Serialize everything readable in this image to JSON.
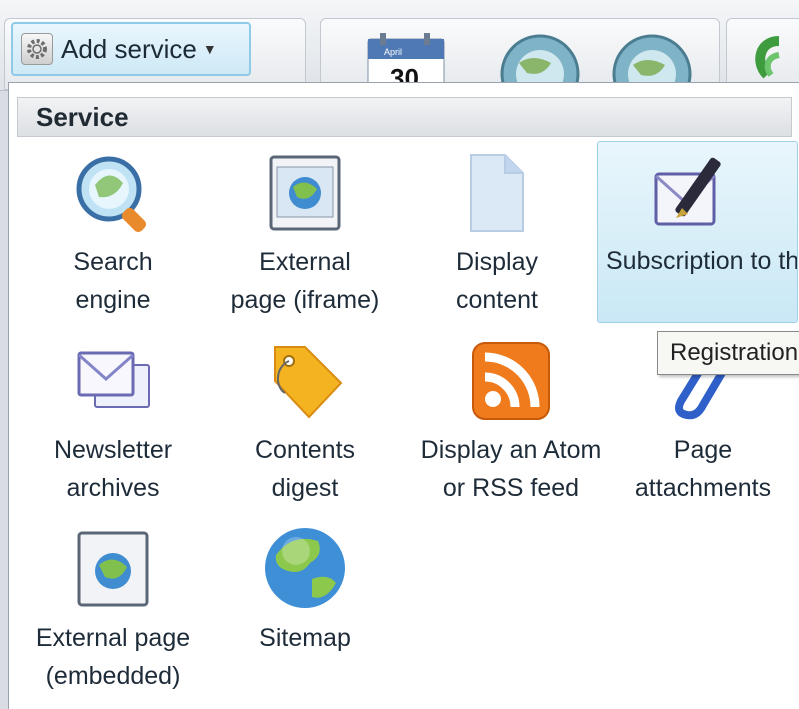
{
  "toolbar": {
    "add_service_label": "Add service",
    "calendar_label": "April",
    "calendar_day": "30"
  },
  "panel": {
    "header": "Service",
    "tooltip": "Registration",
    "services": [
      {
        "label": "Search\nengine",
        "icon": "magnifier-icon"
      },
      {
        "label": "External\npage (iframe)",
        "icon": "external-page-icon"
      },
      {
        "label": "Display\ncontent",
        "icon": "document-icon"
      },
      {
        "label": "Subscription to\nthe newsletter",
        "icon": "newsletter-pen-icon"
      },
      {
        "label": "Newsletter\narchives",
        "icon": "envelopes-icon"
      },
      {
        "label": "Contents\ndigest",
        "icon": "tag-icon"
      },
      {
        "label": "Display an Atom\nor RSS feed",
        "icon": "rss-icon"
      },
      {
        "label": "Page\nattachments",
        "icon": "paperclip-icon"
      },
      {
        "label": "External page\n(embedded)",
        "icon": "embedded-page-icon"
      },
      {
        "label": "Sitemap",
        "icon": "globe-icon"
      }
    ]
  }
}
